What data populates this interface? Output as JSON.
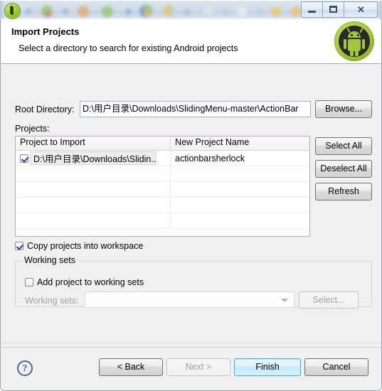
{
  "window": {
    "controls": {
      "minimize": "minimize",
      "restore": "restore",
      "close": "✕"
    }
  },
  "header": {
    "title": "Import Projects",
    "subtitle": "Select a directory to search for existing Android projects",
    "icon": "android-robot-icon"
  },
  "form": {
    "root_directory_label": "Root Directory:",
    "root_directory_value": "D:\\用户目录\\Downloads\\SlidingMenu-master\\ActionBar",
    "root_directory_placeholder": "",
    "browse_label": "Browse...",
    "projects_label": "Projects:"
  },
  "table": {
    "columns": [
      "Project to Import",
      "New Project Name"
    ],
    "rows": [
      {
        "checked": true,
        "project_to_import": "D:\\用户目录\\Downloads\\Slidin...",
        "new_project_name": "actionbarsherlock"
      }
    ],
    "empty_row_count": 4
  },
  "side_buttons": [
    {
      "label": "Select All",
      "name": "select-all-button",
      "disabled": false
    },
    {
      "label": "Deselect All",
      "name": "deselect-all-button",
      "disabled": false
    },
    {
      "label": "Refresh",
      "name": "refresh-button",
      "disabled": false
    }
  ],
  "options": {
    "copy_projects_label": "Copy projects into workspace",
    "copy_projects_checked": true
  },
  "working_sets": {
    "group_title": "Working sets",
    "add_project_label": "Add project to working sets",
    "add_project_checked": false,
    "combo_label": "Working sets:",
    "combo_value": "",
    "select_label": "Select...",
    "disabled": true
  },
  "footer": {
    "help_glyph": "?",
    "buttons": [
      {
        "label": "< Back",
        "name": "back-button",
        "state": "normal"
      },
      {
        "label": "Next >",
        "name": "next-button",
        "state": "disabled"
      },
      {
        "label": "Finish",
        "name": "finish-button",
        "state": "default"
      },
      {
        "label": "Cancel",
        "name": "cancel-button",
        "state": "normal"
      }
    ]
  },
  "colors": {
    "dialog_background": "#f0f0f0",
    "header_background": "#ffffff",
    "accent_default_button": "#2fb0e4",
    "android_green": "#a4c639",
    "help_icon": "#4a6b93"
  }
}
